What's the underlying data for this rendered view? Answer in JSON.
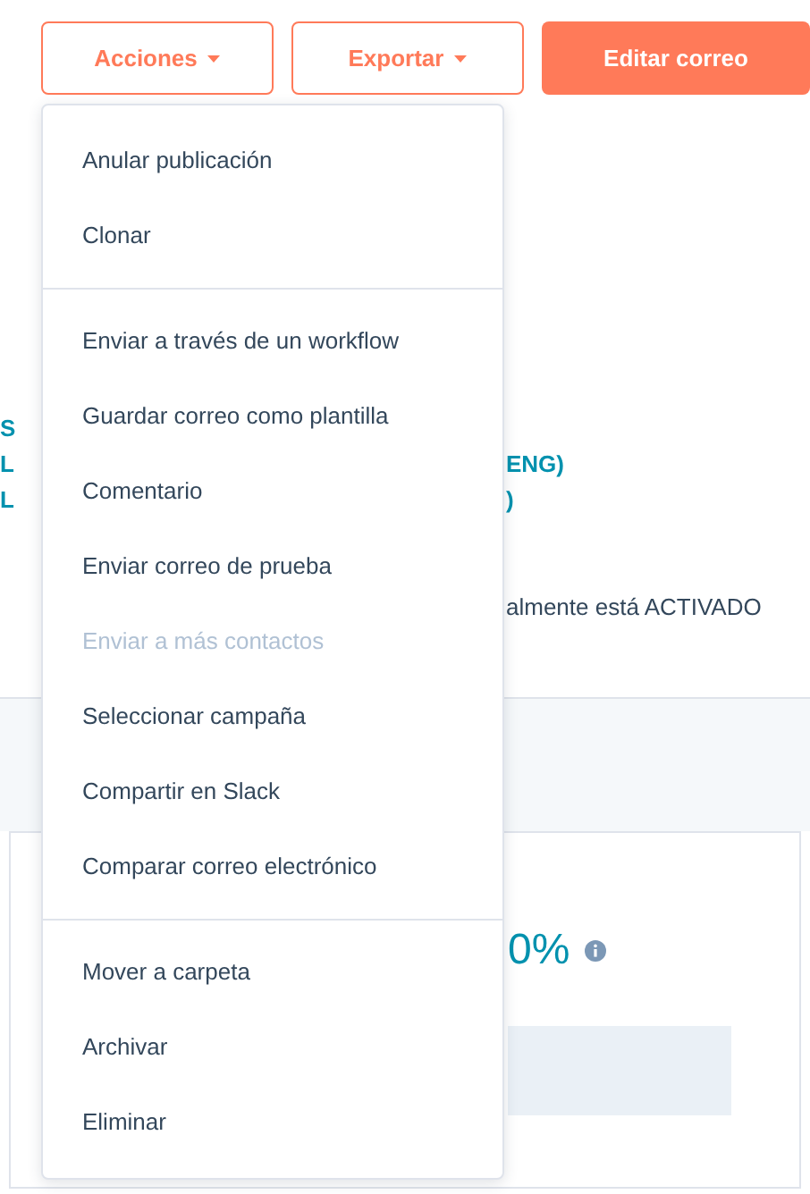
{
  "header_buttons": [
    {
      "label": "Acciones",
      "kind": "dropdown"
    },
    {
      "label": "Exportar",
      "kind": "dropdown"
    },
    {
      "label": "Editar correo",
      "kind": "primary"
    }
  ],
  "background": {
    "link_rows": [
      {
        "left": "S"
      },
      {
        "left": "L",
        "right": "ENG)"
      },
      {
        "left": "L",
        "right": ")"
      }
    ],
    "status_text": "almente está ACTIVADO",
    "metric": "0%"
  },
  "actions_menu": {
    "groups": [
      [
        {
          "label": "Anular publicación",
          "disabled": false
        },
        {
          "label": "Clonar",
          "disabled": false
        }
      ],
      [
        {
          "label": "Enviar a través de un workflow",
          "disabled": false
        },
        {
          "label": "Guardar correo como plantilla",
          "disabled": false
        },
        {
          "label": "Comentario",
          "disabled": false
        },
        {
          "label": "Enviar correo de prueba",
          "disabled": false
        },
        {
          "label": "Enviar a más contactos",
          "disabled": true
        },
        {
          "label": "Seleccionar campaña",
          "disabled": false
        },
        {
          "label": "Compartir en Slack",
          "disabled": false
        },
        {
          "label": "Comparar correo electrónico",
          "disabled": false
        }
      ],
      [
        {
          "label": "Mover a carpeta",
          "disabled": false
        },
        {
          "label": "Archivar",
          "disabled": false
        },
        {
          "label": "Eliminar",
          "disabled": false
        }
      ]
    ]
  }
}
